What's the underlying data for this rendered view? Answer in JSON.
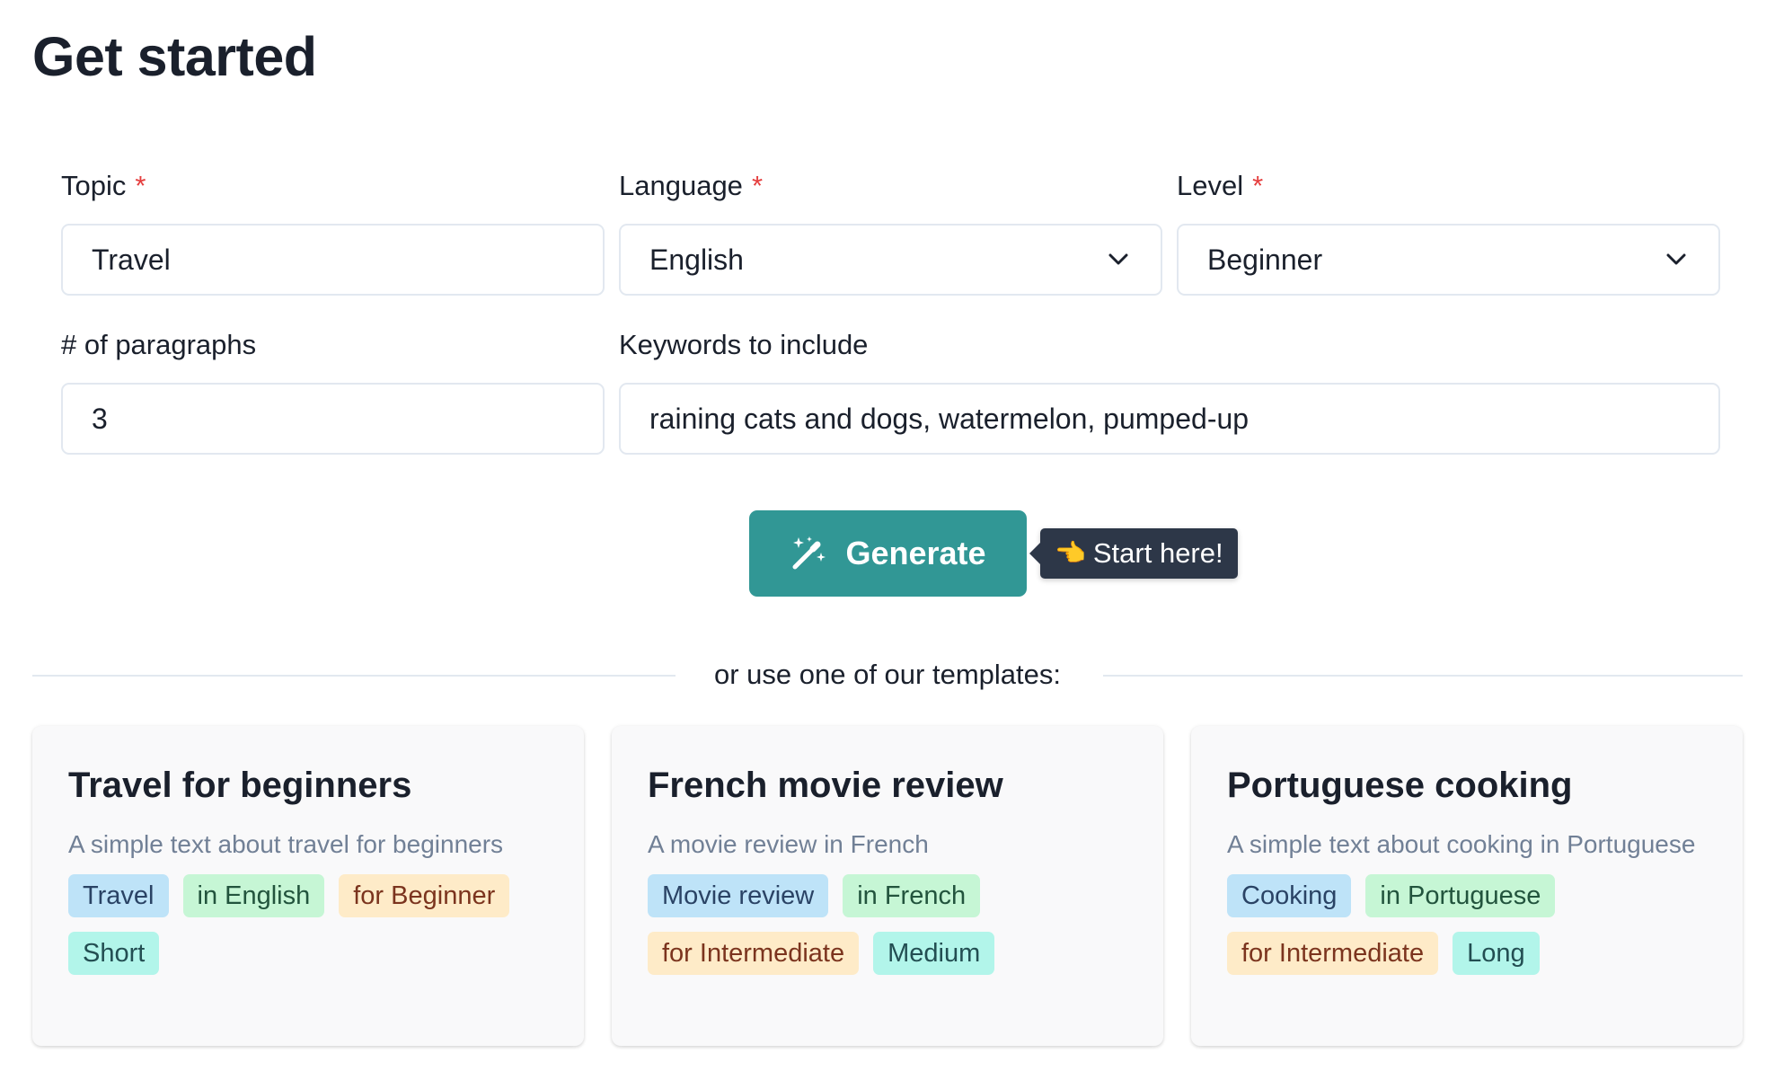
{
  "page": {
    "title": "Get started"
  },
  "form": {
    "topic": {
      "label": "Topic",
      "required_mark": "*",
      "value": "Travel"
    },
    "language": {
      "label": "Language",
      "required_mark": "*",
      "value": "English"
    },
    "level": {
      "label": "Level",
      "required_mark": "*",
      "value": "Beginner"
    },
    "paragraphs": {
      "label": "# of paragraphs",
      "value": "3"
    },
    "keywords": {
      "label": "Keywords to include",
      "value": "raining cats and dogs, watermelon, pumped-up"
    }
  },
  "generate": {
    "label": "Generate",
    "icon": "magic-wand-icon",
    "tooltip": "Start here!",
    "tooltip_icon": "pointing-hand-icon"
  },
  "divider": {
    "text": "or use one of our templates:"
  },
  "templates": [
    {
      "title": "Travel for beginners",
      "description": "A simple text about travel for beginners",
      "tags": [
        "Travel",
        "in English",
        "for Beginner",
        "Short"
      ]
    },
    {
      "title": "French movie review",
      "description": "A movie review in French",
      "tags": [
        "Movie review",
        "in French",
        "for Intermediate",
        "Medium"
      ]
    },
    {
      "title": "Portuguese cooking",
      "description": "A simple text about cooking in Portuguese",
      "tags": [
        "Cooking",
        "in Portuguese",
        "for Intermediate",
        "Long"
      ]
    }
  ],
  "colors": {
    "accent": "#319795",
    "required": "#e53e3e",
    "tag_topic": "#bee3f8",
    "tag_language": "#c6f6d5",
    "tag_level": "#feebc8",
    "tag_length": "#b2f5ea"
  }
}
